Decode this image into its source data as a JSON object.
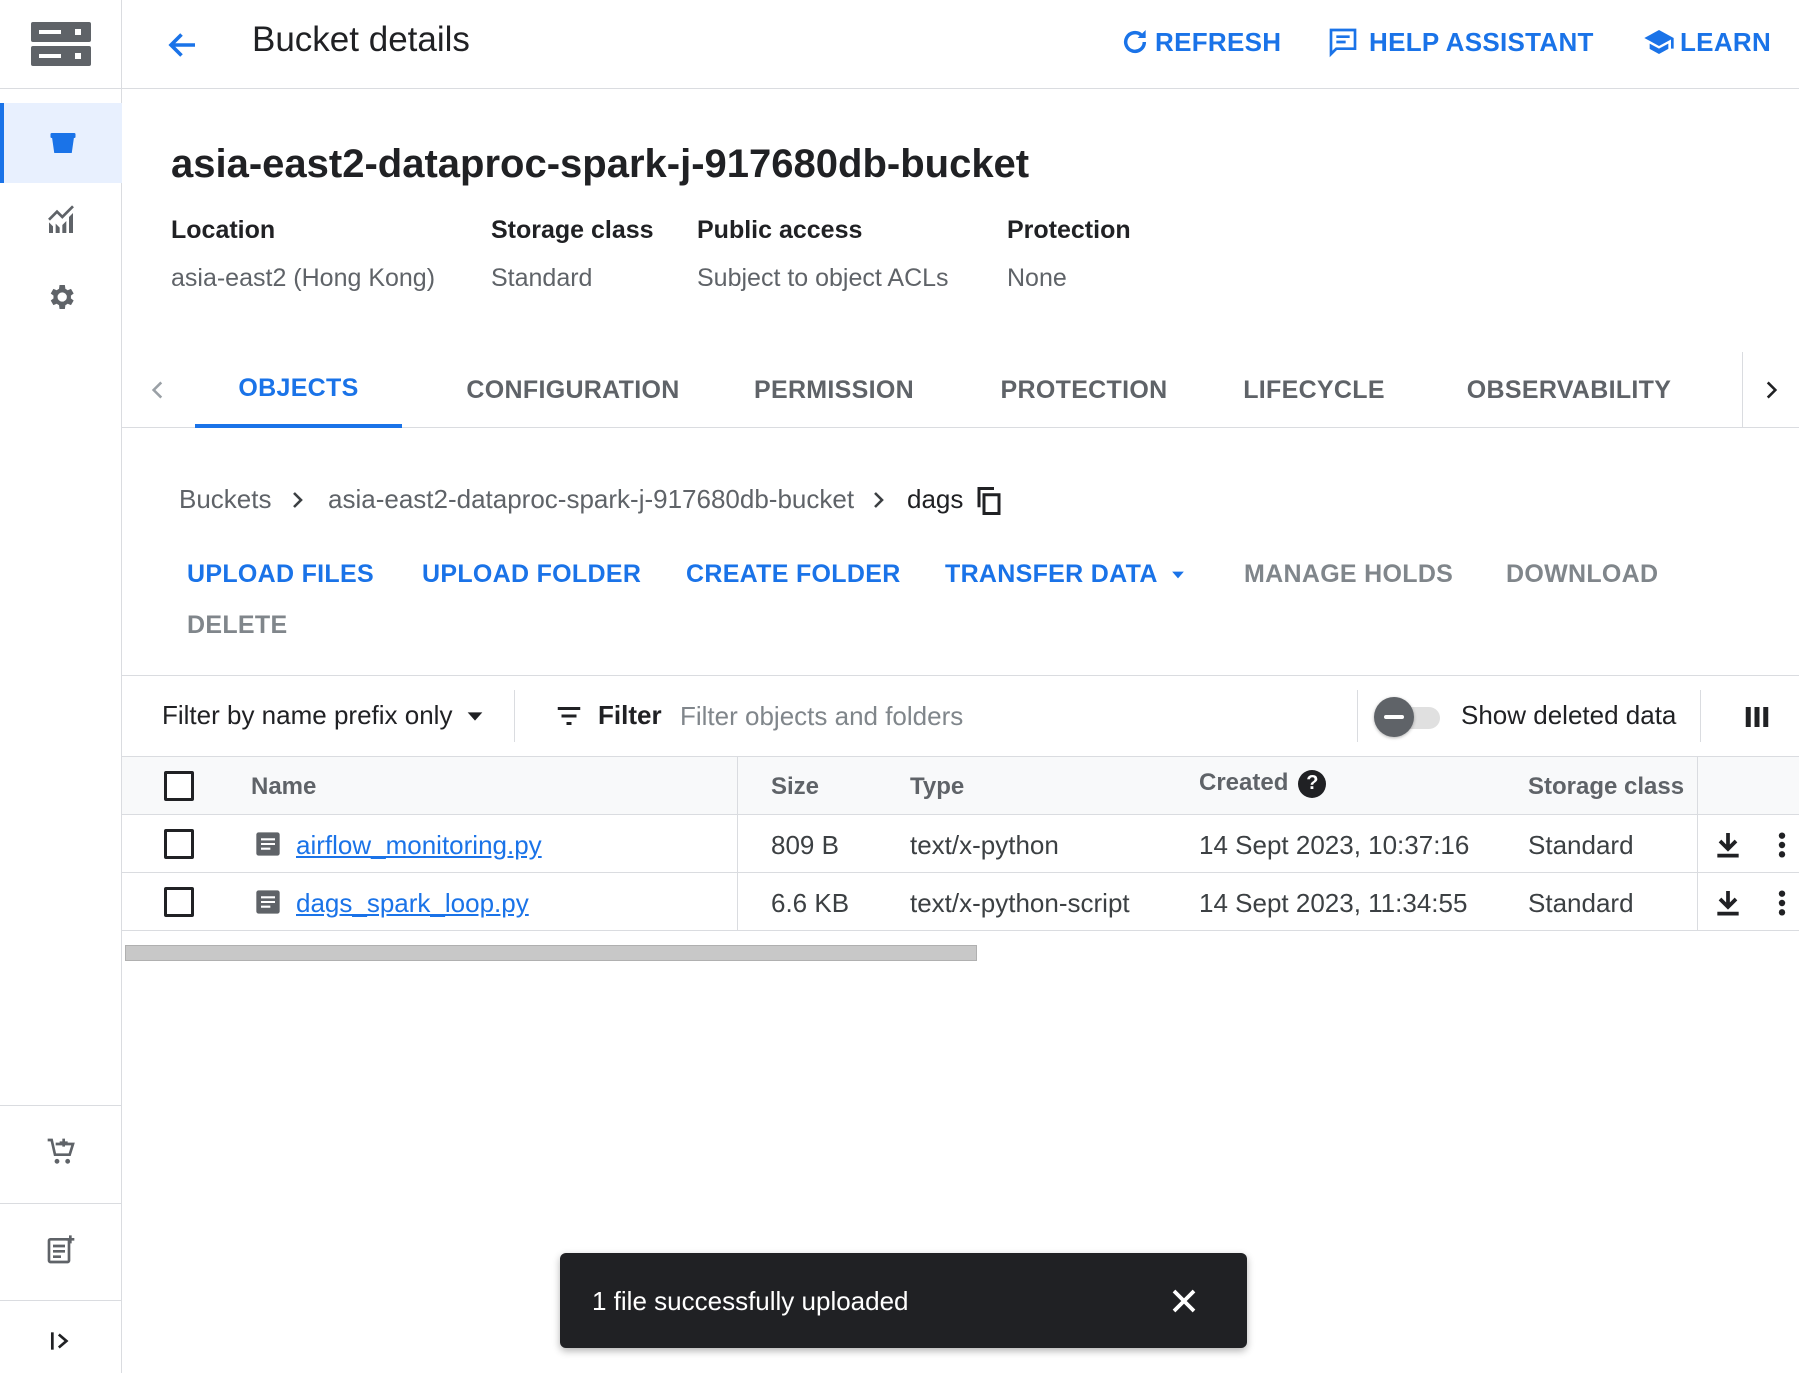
{
  "header": {
    "title": "Bucket details",
    "refresh_label": "REFRESH",
    "help_label": "HELP ASSISTANT",
    "learn_label": "LEARN"
  },
  "bucket": {
    "name": "asia-east2-dataproc-spark-j-917680db-bucket",
    "meta": [
      {
        "label": "Location",
        "value": "asia-east2 (Hong Kong)"
      },
      {
        "label": "Storage class",
        "value": "Standard"
      },
      {
        "label": "Public access",
        "value": "Subject to object ACLs"
      },
      {
        "label": "Protection",
        "value": "None"
      }
    ]
  },
  "tabs": [
    "OBJECTS",
    "CONFIGURATION",
    "PERMISSION",
    "PROTECTION",
    "LIFECYCLE",
    "OBSERVABILITY"
  ],
  "active_tab": "OBJECTS",
  "breadcrumb": [
    "Buckets",
    "asia-east2-dataproc-spark-j-917680db-bucket",
    "dags"
  ],
  "actions": {
    "upload_files": "UPLOAD FILES",
    "upload_folder": "UPLOAD FOLDER",
    "create_folder": "CREATE FOLDER",
    "transfer_data": "TRANSFER DATA",
    "manage_holds": "MANAGE HOLDS",
    "download": "DOWNLOAD",
    "delete": "DELETE"
  },
  "filterbar": {
    "mode_label": "Filter by name prefix only",
    "filter_label": "Filter",
    "placeholder": "Filter objects and folders",
    "toggle_label": "Show deleted data",
    "toggle_on": false
  },
  "table": {
    "columns": {
      "name": "Name",
      "size": "Size",
      "type": "Type",
      "created": "Created",
      "storage_class": "Storage class"
    },
    "rows": [
      {
        "name": "airflow_monitoring.py",
        "size": "809 B",
        "type": "text/x-python",
        "created": "14 Sept 2023, 10:37:16",
        "storage_class": "Standard"
      },
      {
        "name": "dags_spark_loop.py",
        "size": "6.6 KB",
        "type": "text/x-python-script",
        "created": "14 Sept 2023, 11:34:55",
        "storage_class": "Standard"
      }
    ]
  },
  "snackbar": {
    "message": "1 file successfully uploaded"
  },
  "colors": {
    "accent": "#1a73e8",
    "snackbar_bg": "#202124"
  }
}
